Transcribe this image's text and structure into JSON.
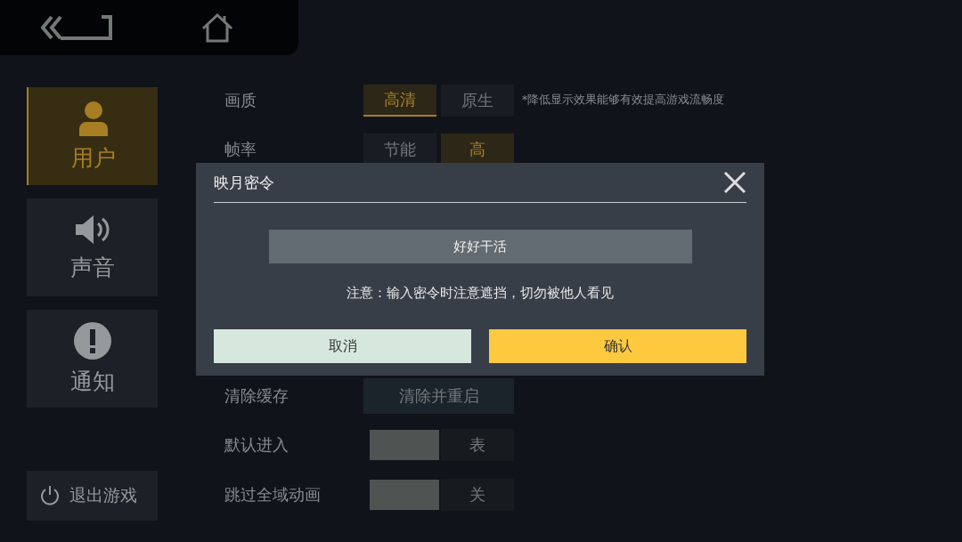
{
  "sidebar": {
    "tabs": [
      {
        "label": "用户",
        "kind": "user",
        "selected": true
      },
      {
        "label": "声音",
        "kind": "sound",
        "selected": false
      },
      {
        "label": "通知",
        "kind": "alert",
        "selected": false
      }
    ],
    "exit_button": "退出游戏"
  },
  "settings": {
    "rows": [
      {
        "kind": "options",
        "label": "画质",
        "options": [
          {
            "label": "高清",
            "selected": true
          },
          {
            "label": "原生",
            "selected": false
          }
        ],
        "note": "*降低显示效果能够有效提高游戏流畅度"
      },
      {
        "kind": "options",
        "label": "帧率",
        "options": [
          {
            "label": "节能",
            "selected": false
          },
          {
            "label": "高",
            "selected": true
          }
        ]
      },
      {
        "kind": "hidden"
      },
      {
        "kind": "hidden"
      },
      {
        "kind": "hidden"
      },
      {
        "kind": "hidden"
      },
      {
        "kind": "action",
        "label": "清除缓存",
        "button": "清除并重启"
      },
      {
        "kind": "toggle",
        "label": "默认进入",
        "value": "表"
      },
      {
        "kind": "toggle",
        "label": "跳过全域动画",
        "value": "关"
      }
    ]
  },
  "dialog": {
    "title": "映月密令",
    "input_value": "好好干活",
    "note": "注意：输入密令时注意遮挡，切勿被他人看见",
    "cancel": "取消",
    "confirm": "确认"
  }
}
